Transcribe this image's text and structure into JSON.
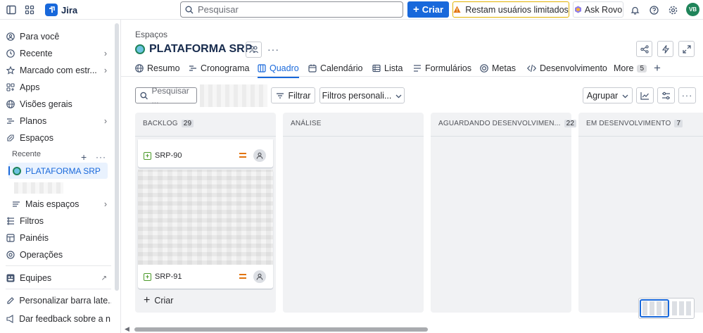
{
  "app": {
    "name": "Jira"
  },
  "topbar": {
    "search_placeholder": "Pesquisar",
    "create_label": "Criar",
    "limited_users_label": "Restam usuários limitados",
    "rovo_label": "Ask Rovo",
    "avatar_initials": "VB"
  },
  "sidebar": {
    "for_you": "Para você",
    "recent": "Recente",
    "starred": "Marcado com estr...",
    "apps": "Apps",
    "views": "Visões gerais",
    "plans": "Planos",
    "spaces": "Espaços",
    "recent_heading": "Recente",
    "active_project": "PLATAFORMA SRP",
    "more_spaces": "Mais espaços",
    "filters": "Filtros",
    "dashboards": "Painéis",
    "operations": "Operações",
    "teams": "Equipes",
    "customize": "Personalizar barra late...",
    "feedback": "Dar feedback sobre a n..."
  },
  "main": {
    "breadcrumb": "Espaços",
    "project_title": "PLATAFORMA SRP",
    "tabs": [
      {
        "label": "Resumo"
      },
      {
        "label": "Cronograma"
      },
      {
        "label": "Quadro"
      },
      {
        "label": "Calendário"
      },
      {
        "label": "Lista"
      },
      {
        "label": "Formulários"
      },
      {
        "label": "Metas"
      },
      {
        "label": "Desenvolvimento"
      },
      {
        "label": "More",
        "count": "5"
      }
    ],
    "toolbar": {
      "search_placeholder": "Pesquisar ...",
      "filter_label": "Filtrar",
      "custom_filters_label": "Filtros personali...",
      "group_label": "Agrupar"
    },
    "columns": [
      {
        "title": "BACKLOG",
        "count": "29"
      },
      {
        "title": "ANÁLISE",
        "count": ""
      },
      {
        "title": "AGUARDANDO DESENVOLVIMEN...",
        "count": "22"
      },
      {
        "title": "EM DESENVOLVIMENTO",
        "count": "7"
      }
    ],
    "cards": [
      {
        "key": "SRP-90"
      },
      {
        "key": "SRP-91"
      }
    ],
    "create_label": "Criar"
  },
  "colors": {
    "brand": "#1868db",
    "warning_border": "#e2b203",
    "avatar_bg": "#1f845a",
    "priority": "#e2740e"
  }
}
